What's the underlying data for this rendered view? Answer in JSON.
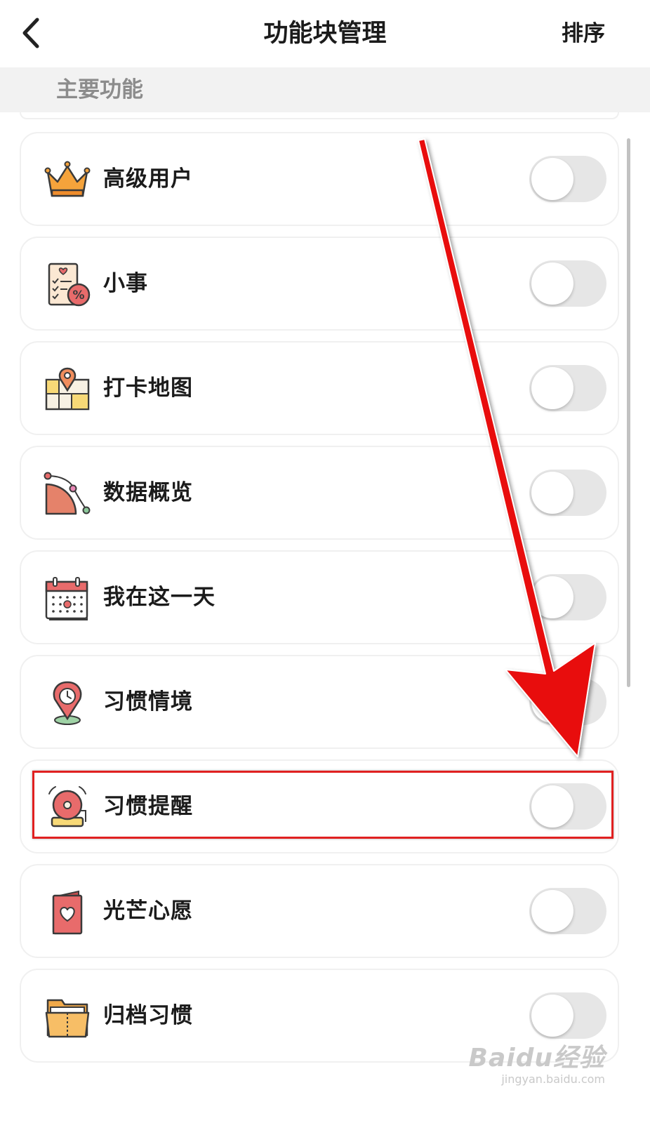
{
  "header": {
    "title": "功能块管理",
    "sort_label": "排序"
  },
  "section": {
    "title": "主要功能"
  },
  "items": [
    {
      "label": "高级用户",
      "icon": "crown-icon",
      "enabled": false
    },
    {
      "label": "小事",
      "icon": "checklist-percent-icon",
      "enabled": false
    },
    {
      "label": "打卡地图",
      "icon": "map-pin-icon",
      "enabled": false
    },
    {
      "label": "数据概览",
      "icon": "pie-chart-icon",
      "enabled": false
    },
    {
      "label": "我在这一天",
      "icon": "calendar-icon",
      "enabled": false
    },
    {
      "label": "习惯情境",
      "icon": "location-clock-icon",
      "enabled": false
    },
    {
      "label": "习惯提醒",
      "icon": "alarm-bell-icon",
      "enabled": false
    },
    {
      "label": "光芒心愿",
      "icon": "heart-card-icon",
      "enabled": false
    },
    {
      "label": "归档习惯",
      "icon": "archive-folder-icon",
      "enabled": false
    }
  ],
  "highlighted_item": "习惯提醒",
  "colors": {
    "accent_orange": "#f5a33b",
    "accent_red": "#e86b6b",
    "annotation_red": "#e8100f",
    "toggle_off": "#e6e6e6"
  },
  "watermark": {
    "main": "Baidu经验",
    "sub": "jingyan.baidu.com"
  }
}
